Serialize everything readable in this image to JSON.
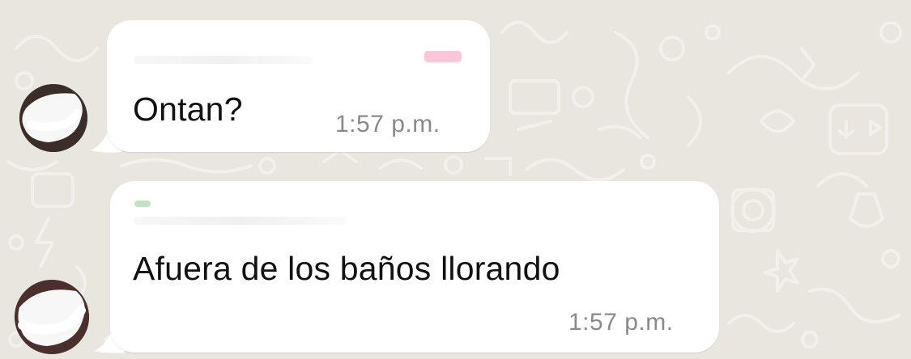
{
  "colors": {
    "wallpaper": "#e9e5df",
    "doodle": "#f3f1ed",
    "bubble": "#ffffff",
    "message_text": "#111111",
    "timestamp": "#8a8a8a",
    "redaction": "#f5f5f5",
    "sender_mark_1": "#e91e63",
    "sender_mark_2": "#4caf50"
  },
  "messages": [
    {
      "sender": "",
      "text": "Ontan?",
      "time": "1:57 p.m."
    },
    {
      "sender": "",
      "text": "Afuera de los baños llorando",
      "time": "1:57 p.m."
    }
  ],
  "icons": [
    "avatar",
    "bubble-tail",
    "wallpaper-doodles"
  ]
}
